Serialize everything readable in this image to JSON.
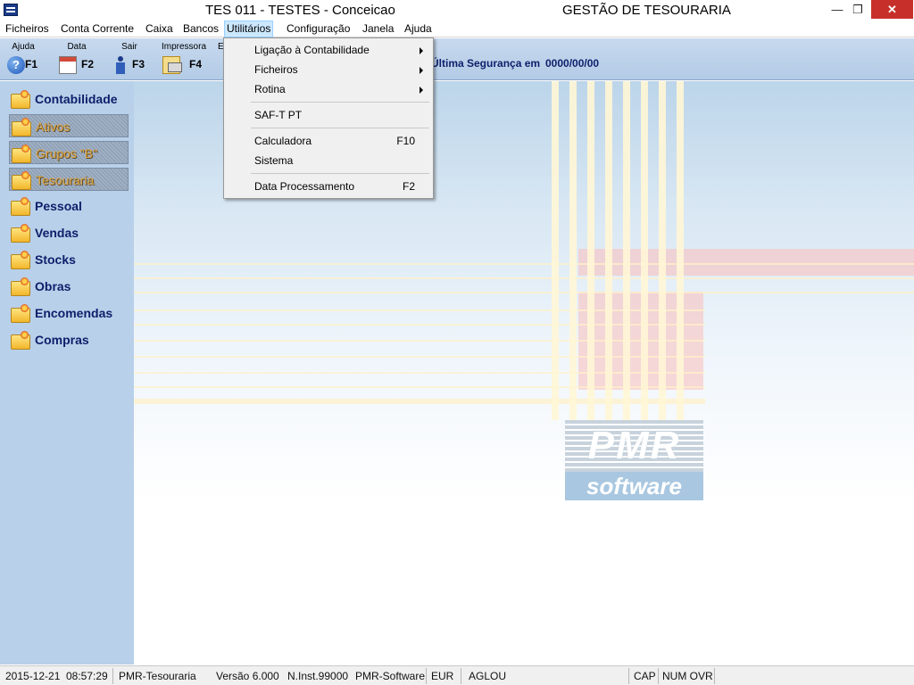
{
  "window": {
    "title": "TES 011 - TESTES - Conceicao",
    "subtitle": "GESTÃO DE TESOURARIA",
    "minimize": "—",
    "maximize": "❐",
    "close": "✕"
  },
  "menubar": {
    "items": [
      "Ficheiros",
      "Conta Corrente",
      "Caixa",
      "Bancos",
      "Utilitários",
      "Configuração",
      "Janela",
      "Ajuda"
    ],
    "active": "Utilitários"
  },
  "toolbar": {
    "buttons": [
      {
        "label": "Ajuda",
        "key": "F1",
        "icon": "help-icon"
      },
      {
        "label": "Data",
        "key": "F2",
        "icon": "calendar-icon"
      },
      {
        "label": "Sair",
        "key": "F3",
        "icon": "exit-icon"
      },
      {
        "label": "Impressora",
        "key": "F4",
        "icon": "printer-icon"
      }
    ],
    "partial_label": "E",
    "security_label": "Última Segurança em",
    "security_value": "0000/00/00"
  },
  "sidebar": {
    "items": [
      {
        "label": "Contabilidade",
        "sub": false
      },
      {
        "label": "Ativos",
        "sub": true
      },
      {
        "label": "Grupos \"B\"",
        "sub": true
      },
      {
        "label": "Tesouraria",
        "sub": true
      },
      {
        "label": "Pessoal",
        "sub": false
      },
      {
        "label": "Vendas",
        "sub": false
      },
      {
        "label": "Stocks",
        "sub": false
      },
      {
        "label": "Obras",
        "sub": false
      },
      {
        "label": "Encomendas",
        "sub": false
      },
      {
        "label": "Compras",
        "sub": false
      }
    ]
  },
  "dropdown": {
    "items": [
      {
        "label": "Ligação à Contabilidade",
        "shortcut": "",
        "submenu": true
      },
      {
        "label": "Ficheiros",
        "shortcut": "",
        "submenu": true
      },
      {
        "label": "Rotina",
        "shortcut": "",
        "submenu": true
      },
      {
        "label": "SAF-T PT",
        "shortcut": "",
        "submenu": false
      },
      {
        "label": "Calculadora",
        "shortcut": "F10",
        "submenu": false
      },
      {
        "label": "Sistema",
        "shortcut": "",
        "submenu": false
      },
      {
        "label": "Data Processamento",
        "shortcut": "F2",
        "submenu": false
      }
    ]
  },
  "logo": {
    "brand": "PMR",
    "sub": "software"
  },
  "statusbar": {
    "date": "2015-12-21",
    "time": "08:57:29",
    "app": "PMR-Tesouraria",
    "version": "Versão  6.000",
    "inst": "N.Inst.99000",
    "vendor": "PMR-Software",
    "currency": "EUR",
    "user": "AGLOU",
    "cap": "CAP",
    "num": "NUM OVR"
  },
  "colors": {
    "accent": "#0c1f6a",
    "sidebar": "#b9d0ea",
    "toolbar": "#c7d9ee",
    "menu_active": "#cce8ff"
  }
}
